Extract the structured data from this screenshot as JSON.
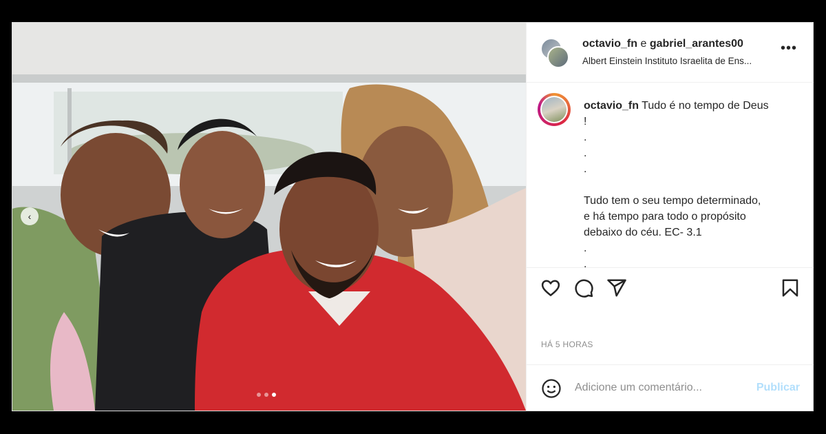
{
  "post": {
    "header": {
      "user1": "octavio_fn",
      "connector": "e",
      "user2": "gabriel_arantes00",
      "location": "Albert Einstein Instituto Israelita de Ens..."
    },
    "caption": {
      "username": "octavio_fn",
      "text": "Tudo é no tempo de Deus\n!\n.\n.\n.\n\nTudo tem o seu tempo determinado,\ne há tempo para todo o propósito\ndebaixo do céu. EC- 3.1\n.\n."
    },
    "timestamp": "HÁ 5 HORAS",
    "comment": {
      "placeholder": "Adicione um comentário...",
      "publish_label": "Publicar"
    },
    "carousel": {
      "current_index": 3,
      "total": 3
    }
  },
  "colors": {
    "publish_disabled": "#b2dffc",
    "hoodie_red": "#d12a2f",
    "border": "#dbdbdb"
  },
  "icons": [
    "heart-icon",
    "comment-icon",
    "share-icon",
    "bookmark-icon",
    "emoji-icon",
    "chevron-left-icon",
    "more-icon"
  ]
}
